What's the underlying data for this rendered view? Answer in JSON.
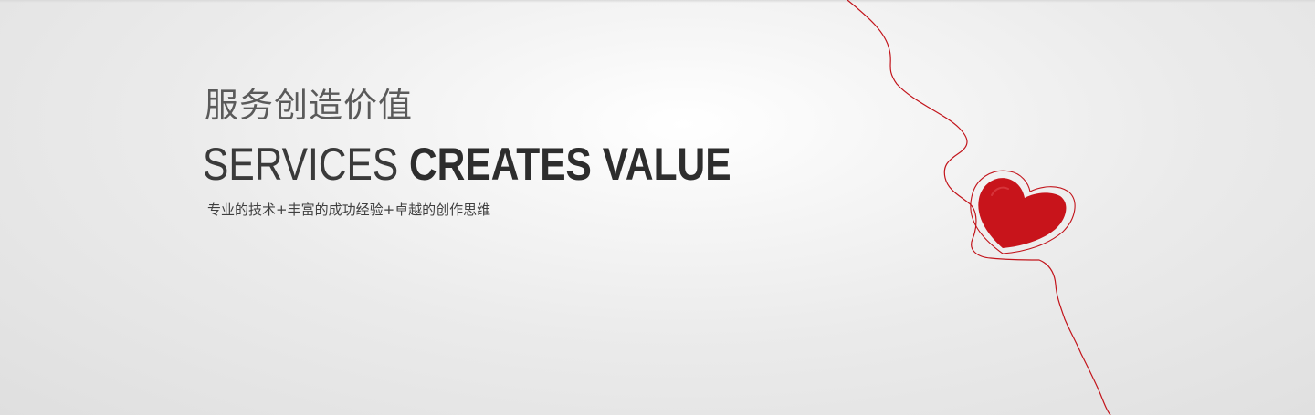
{
  "banner": {
    "title_cn": "服务创造价值",
    "title_en_light": "SERVICES",
    "title_en_bold": "CREATES VALUE",
    "tagline": "专业的技术+丰富的成功经验+卓越的创作思维"
  },
  "colors": {
    "heart_red": "#c8141b",
    "string_red": "#c2141b",
    "title_dark": "#2f2f2f",
    "title_grey": "#5a5a5a"
  },
  "icons": {
    "decoration": "heart-on-string-icon"
  }
}
